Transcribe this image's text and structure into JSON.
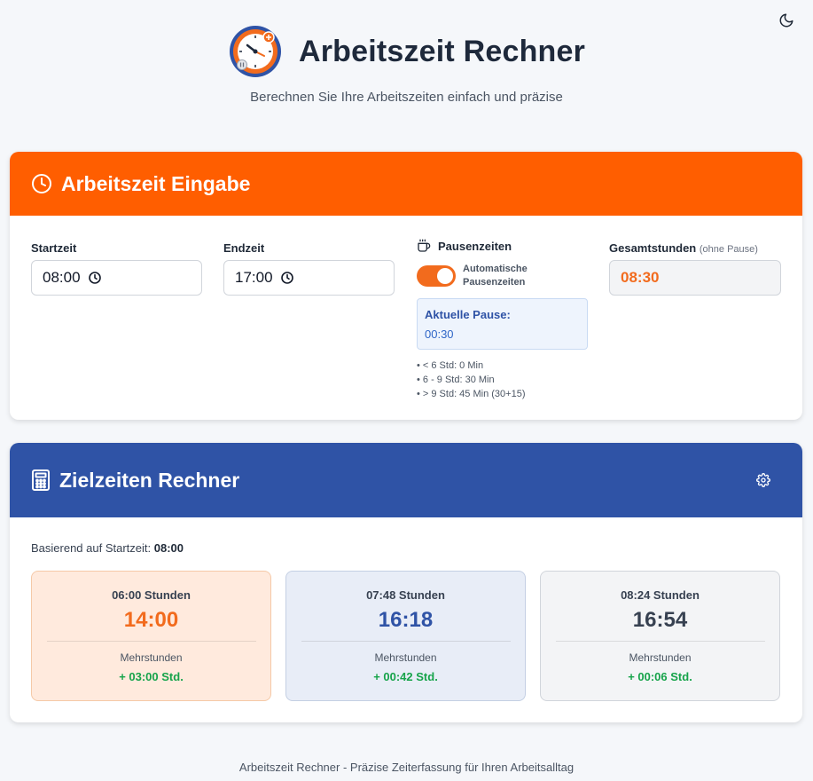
{
  "header": {
    "title": "Arbeitszeit Rechner",
    "subtitle": "Berechnen Sie Ihre Arbeitszeiten einfach und präzise"
  },
  "input_card": {
    "title": "Arbeitszeit Eingabe",
    "start_label": "Startzeit",
    "start_value": "08:00",
    "end_label": "Endzeit",
    "end_value": "17:00",
    "pause_title": "Pausenzeiten",
    "auto_pause_label": "Automatische Pausenzeiten",
    "auto_pause_enabled": true,
    "current_pause_label": "Aktuelle Pause:",
    "current_pause_value": "00:30",
    "rules": [
      "• < 6 Std: 0 Min",
      "• 6 - 9 Std: 30 Min",
      "• > 9 Std: 45 Min (30+15)"
    ],
    "total_label": "Gesamtstunden",
    "total_note": "(ohne Pause)",
    "total_value": "08:30"
  },
  "target_card": {
    "title": "Zielzeiten Rechner",
    "based_on_label": "Basierend auf Startzeit:",
    "based_on_value": "08:00",
    "tiles": [
      {
        "hours": "06:00 Stunden",
        "end": "14:00",
        "over_label": "Mehrstunden",
        "over_value": "+ 03:00 Std."
      },
      {
        "hours": "07:48 Stunden",
        "end": "16:18",
        "over_label": "Mehrstunden",
        "over_value": "+ 00:42 Std."
      },
      {
        "hours": "08:24 Stunden",
        "end": "16:54",
        "over_label": "Mehrstunden",
        "over_value": "+ 00:06 Std."
      }
    ]
  },
  "footer": "Arbeitszeit Rechner - Präzise Zeiterfassung für Ihren Arbeitsalltag",
  "icons": {
    "theme": "moon-icon",
    "logo": "clock-logo-icon",
    "input_header": "clock-icon",
    "time_picker": "clock-icon",
    "pause": "coffee-cup-icon",
    "target_header": "calculator-icon",
    "settings": "gear-icon"
  },
  "colors": {
    "orange": "#ff5e00",
    "blue": "#2f53a6",
    "green": "#16a34a",
    "background": "#f5f7fa"
  }
}
